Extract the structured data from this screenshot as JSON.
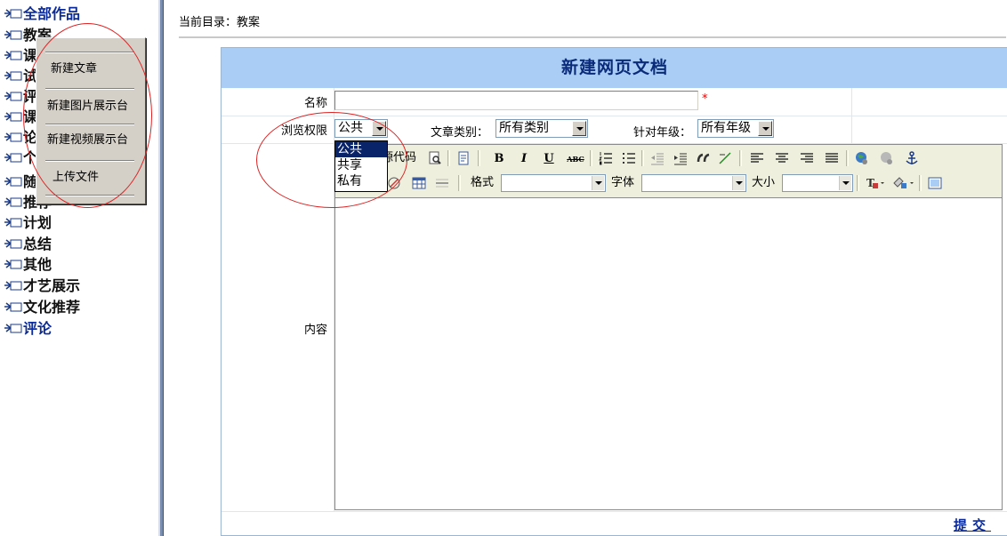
{
  "tree": {
    "items": [
      "全部作品",
      "教案",
      "课",
      "试",
      "评",
      "课",
      "论",
      "个",
      "随",
      "推荐",
      "计划",
      "总结",
      "其他",
      "才艺展示",
      "文化推荐",
      "评论"
    ]
  },
  "context_menu": {
    "items": [
      "新建文章",
      "新建图片展示台",
      "新建视频展示台",
      "上传文件"
    ]
  },
  "breadcrumb": "当前目录：教案",
  "form": {
    "title": "新建网页文档",
    "name_label": "名称",
    "required_mark": "*",
    "permission_label": "浏览权限",
    "permission_value": "公共",
    "permission_options": [
      "公共",
      "共享",
      "私有"
    ],
    "category_label": "文章类别：",
    "category_value": "所有类别",
    "grade_label": "针对年级：",
    "grade_value": "所有年级",
    "content_label": "内容",
    "submit_label": "提交"
  },
  "editor": {
    "source_label": "源代码",
    "format_label": "格式",
    "font_label": "字体",
    "size_label": "大小",
    "bold_glyph": "B",
    "italic_glyph": "I",
    "underline_glyph": "U",
    "strike_glyph": "ABC"
  },
  "colors": {
    "header_bg": "#a9cdf5",
    "title_color": "#0b2b7a",
    "link_color": "#0b2b9c",
    "ring_color": "#d22222"
  }
}
